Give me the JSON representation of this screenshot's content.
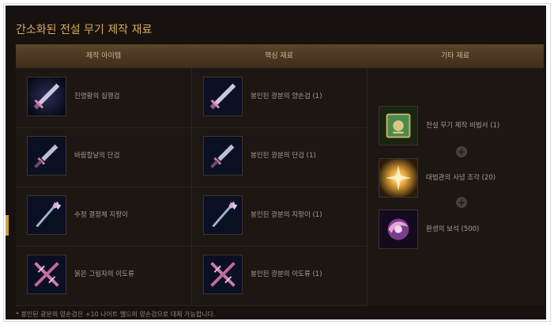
{
  "title": "간소화된 전설 무기 제작 재료",
  "headers": {
    "craft_item": "제작 아이템",
    "core_material": "핵심 재료",
    "other_material": "기타 재료"
  },
  "rows": [
    {
      "item": "진명황의 집행검",
      "item_icon": "sword-icon",
      "core": "봉인된 광분의 양손검 (1)",
      "core_icon": "sword-icon"
    },
    {
      "item": "바람칼날의 단검",
      "item_icon": "dagger-icon",
      "core": "봉인된 광분의 단검 (1)",
      "core_icon": "dagger-icon"
    },
    {
      "item": "수정 결정체 지팡이",
      "item_icon": "staff-icon",
      "core": "봉인된 광분의 지팡이 (1)",
      "core_icon": "staff-icon"
    },
    {
      "item": "붉은 그림자의 이도류",
      "item_icon": "dual-blades-icon",
      "core": "봉인된 광분의 이도류 (1)",
      "core_icon": "dual-blades-icon"
    }
  ],
  "other_materials": [
    {
      "name": "전설 무기 제작 비법서 (1)",
      "icon": "recipe-book-icon"
    },
    {
      "name": "대법관의 사념 조각 (20)",
      "icon": "glowing-fragment-icon"
    },
    {
      "name": "환생의 보석 (500)",
      "icon": "rebirth-gem-icon"
    }
  ],
  "plus_symbol": "+",
  "note": "* 봉인된 광분의 양손검은 +10 나이트 밸드의 양손검으로 대체 가능합니다.",
  "colors": {
    "panel_bg": "#17120f",
    "title": "#d8aa5c",
    "header_bg": "#4d3a24",
    "text": "#a79c8e"
  }
}
